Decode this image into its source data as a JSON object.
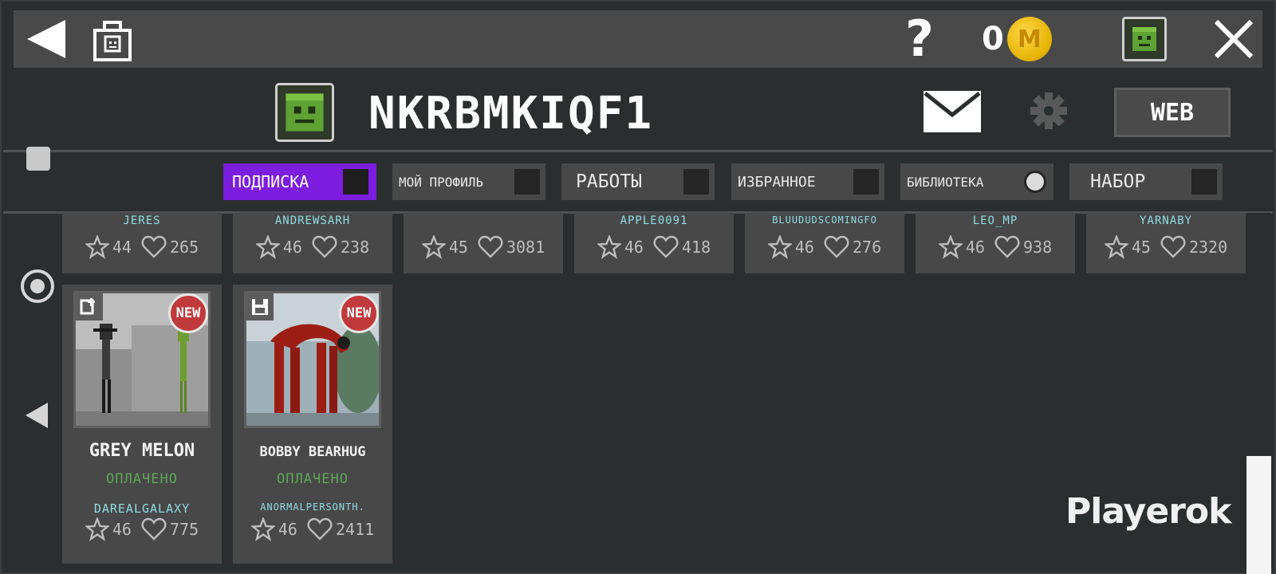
{
  "topbar": {
    "coin_count": "0",
    "coin_letter": "M"
  },
  "profile": {
    "username": "NKRBMKIQF1",
    "web_label": "WEB"
  },
  "tabs": [
    {
      "label": "ПОДПИСКА",
      "active": true
    },
    {
      "label": "МОЙ ПРОФИЛЬ",
      "active": false
    },
    {
      "label": "РАБОТЫ",
      "active": false
    },
    {
      "label": "ИЗБРАННОЕ",
      "active": false
    },
    {
      "label": "БИБЛИОТЕКА",
      "active": false
    },
    {
      "label": "НАБОР",
      "active": false
    }
  ],
  "top_cards": [
    {
      "author": "JERES",
      "stars": "44",
      "likes": "265"
    },
    {
      "author": "ANDREWSARH",
      "stars": "46",
      "likes": "238"
    },
    {
      "author": "",
      "stars": "45",
      "likes": "3081"
    },
    {
      "author": "APPLE0091",
      "stars": "46",
      "likes": "418"
    },
    {
      "author": "BLUUDUDSCOMINGFO",
      "stars": "46",
      "likes": "276"
    },
    {
      "author": "LEO_MP",
      "stars": "46",
      "likes": "938"
    },
    {
      "author": "YARNABY",
      "stars": "45",
      "likes": "2320"
    }
  ],
  "cards": [
    {
      "title": "GREY MELON",
      "status": "ОПЛАЧЕНО",
      "author": "DAREALGALAXY",
      "stars": "46",
      "likes": "775",
      "badge": "NEW"
    },
    {
      "title": "BOBBY BEARHUG",
      "status": "ОПЛАЧЕНО",
      "author": "ANORMALPERSONTH.",
      "stars": "46",
      "likes": "2411",
      "badge": "NEW"
    }
  ],
  "watermark": "Playerok",
  "colors": {
    "accent": "#7d1de0",
    "author": "#8fdce3",
    "paid": "#5fa65a",
    "badge": "#c0393b",
    "coin": "#e4b100"
  }
}
